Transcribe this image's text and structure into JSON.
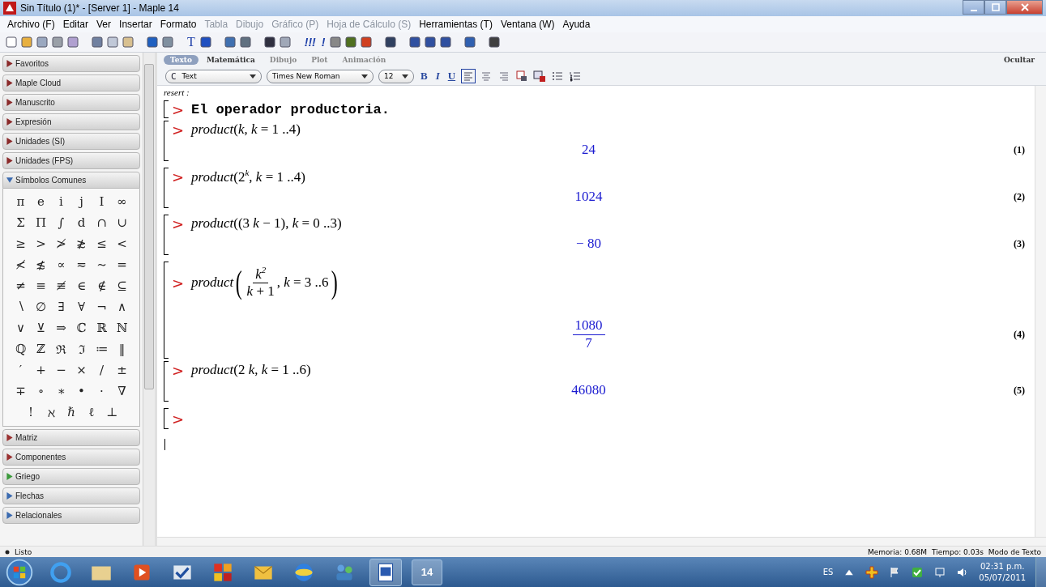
{
  "window": {
    "title": "Sin Título (1)* - [Server 1] - Maple 14"
  },
  "menu": [
    {
      "label": "Archivo (F)",
      "disabled": false
    },
    {
      "label": "Editar",
      "disabled": false
    },
    {
      "label": "Ver",
      "disabled": false
    },
    {
      "label": "Insertar",
      "disabled": false
    },
    {
      "label": "Formato",
      "disabled": false
    },
    {
      "label": "Tabla",
      "disabled": true
    },
    {
      "label": "Dibujo",
      "disabled": true
    },
    {
      "label": "Gráfico (P)",
      "disabled": true
    },
    {
      "label": "Hoja de Cálculo (S)",
      "disabled": true
    },
    {
      "label": "Herramientas (T)",
      "disabled": false
    },
    {
      "label": "Ventana (W)",
      "disabled": false
    },
    {
      "label": "Ayuda",
      "disabled": false
    }
  ],
  "toolbar_glyphs": [
    "T",
    "!!!",
    "!"
  ],
  "palettes_top": [
    {
      "label": "Favoritos",
      "color": "#8b2a2a"
    },
    {
      "label": "Maple Cloud",
      "color": "#8b2a2a"
    },
    {
      "label": "Manuscrito",
      "color": "#8b2a2a"
    },
    {
      "label": "Expresión",
      "color": "#8b2a2a"
    },
    {
      "label": "Unidades (SI)",
      "color": "#8b2a2a"
    },
    {
      "label": "Unidades (FPS)",
      "color": "#8b2a2a"
    }
  ],
  "open_palette": {
    "label": "Símbolos Comunes",
    "expanded": true
  },
  "symbols": [
    [
      "π",
      "e",
      "i",
      "j",
      "I",
      "∞"
    ],
    [
      "Σ",
      "Π",
      "∫",
      "d",
      "∩",
      "∪"
    ],
    [
      "≥",
      ">",
      "≯",
      "≵",
      "≤",
      "<"
    ],
    [
      "≮",
      "≴",
      "∝",
      "≂",
      "∼",
      "="
    ],
    [
      "≠",
      "≡",
      "≢",
      "∈",
      "∉",
      "⊆"
    ],
    [
      "∖",
      "∅",
      "∃",
      "∀",
      "¬",
      "∧"
    ],
    [
      "∨",
      "⊻",
      "⇒",
      "ℂ",
      "ℝ",
      "ℕ"
    ],
    [
      "ℚ",
      "ℤ",
      "ℜ",
      "ℑ",
      "≔",
      "‖"
    ],
    [
      "′",
      "+",
      "−",
      "×",
      "/",
      "±"
    ],
    [
      "∓",
      "∘",
      "∗",
      "•",
      "·",
      "∇"
    ],
    [
      "!",
      "ℵ",
      "ℏ",
      "ℓ",
      "⊥"
    ]
  ],
  "palettes_bottom": [
    {
      "label": "Matriz",
      "color": "#9a3030"
    },
    {
      "label": "Componentes",
      "color": "#9a3030"
    },
    {
      "label": "Griego",
      "color": "#3a9a3a"
    },
    {
      "label": "Flechas",
      "color": "#3a6ab0"
    },
    {
      "label": "Relacionales",
      "color": "#3a6ab0"
    }
  ],
  "format_tabs": [
    {
      "label": "Texto",
      "selected": true
    },
    {
      "label": "Matemática",
      "selected": false
    },
    {
      "label": "Dibujo",
      "selected": false
    },
    {
      "label": "Plot",
      "selected": false
    },
    {
      "label": "Animación",
      "selected": false
    }
  ],
  "hide_label": "Ocultar",
  "style_bar": {
    "style_icon": "C",
    "style": "Text",
    "font": "Times New Roman",
    "size": "12",
    "bold": "B",
    "italic": "I",
    "underline": "U"
  },
  "command": "resert :",
  "groups": [
    {
      "prompt": ">",
      "kind": "text",
      "text": "El operador productoria."
    },
    {
      "prompt": ">",
      "kind": "math",
      "math": "*product*(*k*, *k* = 1 ..4)",
      "output": {
        "kind": "number",
        "value": "24",
        "label": "(1)"
      }
    },
    {
      "prompt": ">",
      "kind": "math",
      "math": "*product*(2$^{k}$, *k* = 1 ..4)",
      "output": {
        "kind": "number",
        "value": "1024",
        "label": "(2)"
      }
    },
    {
      "prompt": ">",
      "kind": "math",
      "math": "*product*((3 *k* − 1), *k* = 0 ..3)",
      "output": {
        "kind": "number",
        "value": "− 80",
        "label": "(3)"
      }
    },
    {
      "prompt": ">",
      "kind": "fraction",
      "prefix": "*product*",
      "open": "(",
      "numerator": "*k*$^{2}$",
      "denominator": "*k* + 1",
      "suffix": ", *k* = 3 ..6",
      "close": ")",
      "output": {
        "kind": "fraction",
        "numerator": "1080",
        "denominator": "7",
        "label": "(4)"
      }
    },
    {
      "prompt": ">",
      "kind": "math",
      "math": "*product*(2 *k*, *k* = 1 ..6)",
      "output": {
        "kind": "number",
        "value": "46080",
        "label": "(5)"
      }
    },
    {
      "prompt": ">",
      "kind": "empty"
    }
  ],
  "status": {
    "text": "Listo",
    "memory": "Memoria: 0.68M",
    "time": "Tiempo: 0.03s",
    "mode": "Modo de Texto"
  },
  "taskbar": {
    "language": "ES",
    "clock": "02:31 p.m.",
    "date": "05/07/2011",
    "app_label": "14"
  }
}
